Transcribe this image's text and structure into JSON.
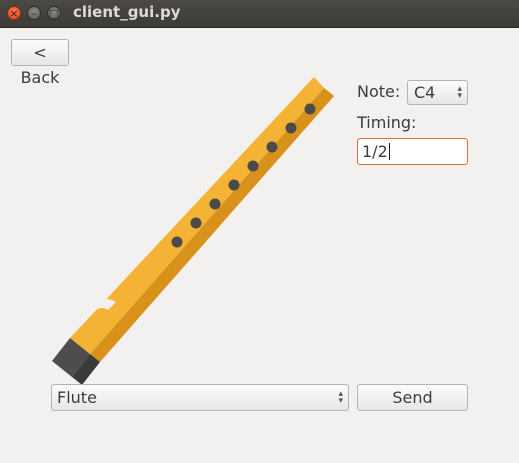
{
  "window": {
    "title": "client_gui.py"
  },
  "toolbar": {
    "back_label": "< Back"
  },
  "form": {
    "note_label": "Note:",
    "note_value": "C4",
    "timing_label": "Timing:",
    "timing_value": "1/2"
  },
  "footer": {
    "instrument_value": "Flute",
    "send_label": "Send"
  },
  "colors": {
    "flute_body": "#f5b335",
    "flute_shadow": "#d8921c",
    "flute_holes": "#4a4a4a",
    "mouthpiece": "#4d4d4d",
    "focus_border": "#dd6d3a",
    "titlebar": "#3c3b37"
  }
}
